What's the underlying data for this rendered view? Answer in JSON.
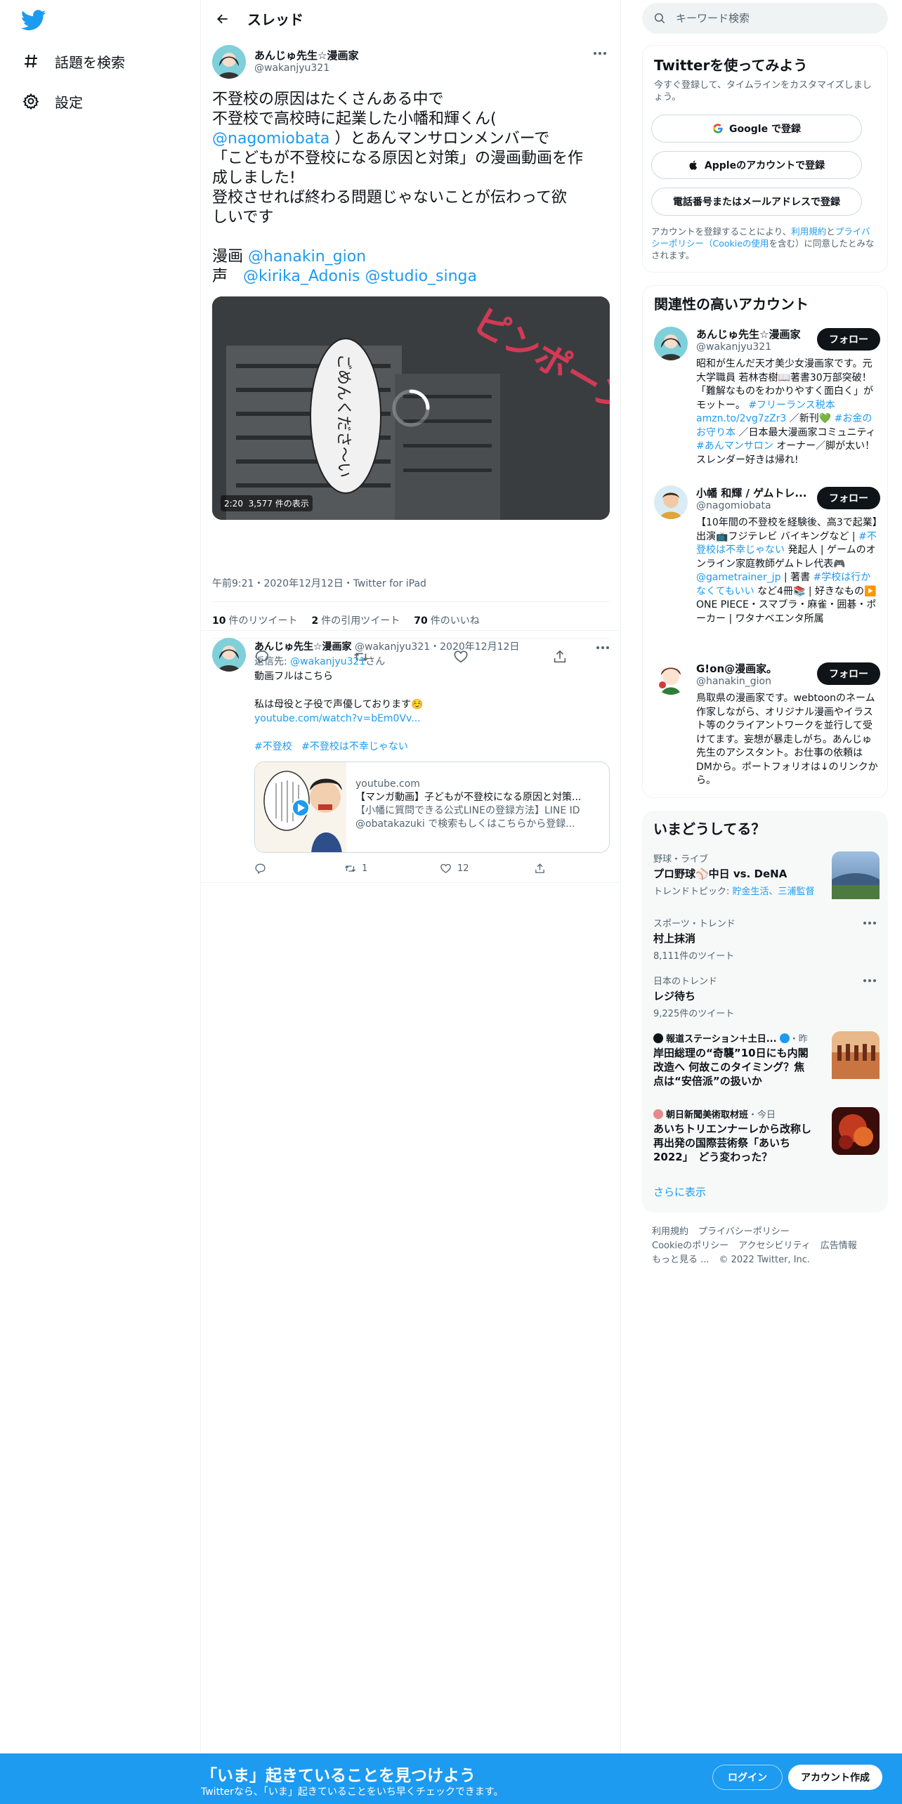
{
  "nav": {
    "items": [
      {
        "label": "話題を検索",
        "icon": "hashtag-icon"
      },
      {
        "label": "設定",
        "icon": "gear-icon"
      }
    ]
  },
  "header": {
    "title": "スレッド"
  },
  "main_tweet": {
    "name": "あんじゅ先生☆漫画家",
    "handle": "@wakanjyu321",
    "text_lines": [
      "不登校の原因はたくさんある中で",
      "不登校で高校時に起業した小幡和輝くん(",
      "@nagomiobata",
      " ）とあんマンサロンメンバーで",
      "「こどもが不登校になる原因と対策」の漫画動画を作",
      "成しました!",
      "登校させれば終わる問題じゃないことが伝わって欲",
      "しいです",
      "",
      "漫画 ",
      "@hanakin_gion",
      "声　",
      "@kirika_Adonis",
      " ",
      "@studio_singa"
    ],
    "video": {
      "duration": "2:20",
      "views": "3,577 件の表示",
      "art_text_1": "ピンポーン",
      "art_text_2": "ごめんくださ〜い"
    },
    "timestamp": "午前9:21・2020年12月12日・Twitter for iPad",
    "stats": {
      "retweets": "10",
      "retweets_label": "件のリツイート",
      "quotes": "2",
      "quotes_label": "件の引用ツイート",
      "likes": "70",
      "likes_label": "件のいいね"
    }
  },
  "reply": {
    "name": "あんじゅ先生☆漫画家",
    "handle": "@wakanjyu321",
    "date": "・2020年12月12日",
    "reply_to_prefix": "返信先: ",
    "reply_to_handle": "@wakanjyu321",
    "reply_to_suffix": "さん",
    "line1": "動画フルはこちら",
    "line2": "私は母役と子役で声優しております☺️",
    "link": "youtube.com/watch?v=bEm0Vv...",
    "hashtag1": "#不登校",
    "hashtag2": "#不登校は不幸じゃない",
    "card": {
      "domain": "youtube.com",
      "title": "【マンガ動画】子どもが不登校になる原因と対策...",
      "desc1": "【小幡に質問できる公式LINEの登録方法】LINE ID",
      "desc2": "@obatakazuki で検索もしくはこちらから登録..."
    },
    "stats": {
      "replies": "",
      "retweets": "1",
      "likes": "12"
    }
  },
  "search": {
    "placeholder": "キーワード検索"
  },
  "signup_box": {
    "title": "Twitterを使ってみよう",
    "subtitle": "今すぐ登録して、タイムラインをカスタマイズしましょう。",
    "google": "Google で登録",
    "apple": "Appleのアカウントで登録",
    "phone": "電話番号またはメールアドレスで登録",
    "terms_pre": "アカウントを登録することにより、",
    "terms_link1": "利用規約",
    "terms_mid": "と",
    "terms_link2": "プライバシーポリシー（Cookieの使用",
    "terms_post": "を含む）に同意したとみなされます。"
  },
  "related": {
    "title": "関連性の高いアカウント",
    "follow": "フォロー",
    "accounts": [
      {
        "name": "あんじゅ先生☆漫画家",
        "handle": "@wakanjyu321"
      },
      {
        "name": "小幡 和輝 / ゲムトレ...",
        "handle": "@nagomiobata"
      },
      {
        "name": "G!on@漫画家。",
        "handle": "@hanakin_gion"
      }
    ],
    "bio1": {
      "p1": "昭和が生んだ天才美少女漫画家です。元大学職員 若林杏樹📖著書30万部突破！「難解なものをわかりやすく面白く」がモットー。",
      "l1": "#フリーランス税本",
      "l2": "amzn.to/2vg7zZr3",
      "p2": "／新刊💚",
      "l3": "#お金のお守り本",
      "p3": "／日本最大漫画家コミュニティ",
      "l4": "#あんマンサロン",
      "p4": "オーナー／脚が太い！スレンダー好きは帰れ!"
    },
    "bio2": {
      "p1": "【10年間の不登校を経験後、高3で起業】出演📺フジテレビ バイキングなど |",
      "l1": "#不登校は不幸じゃない",
      "p2": "発起人 | ゲームのオンライン家庭教師ゲムトレ代表🎮",
      "l2": "@gametrainer_jp",
      "p3": "| 著書",
      "l3": "#学校は行かなくてもいい",
      "p4": "など4冊📚 | 好きなもの▶️ ONE PIECE・スマブラ・麻雀・囲碁・ポーカー | ワタナベエンタ所属"
    },
    "bio3": "鳥取県の漫画家です。webtoonのネーム作家しながら、オリジナル漫画やイラスト等のクライアントワークを並行して受けてます。妄想が暴走しがち。あんじゅ先生のアシスタント。お仕事の依頼はDMから。ポートフォリオは↓のリンクから。"
  },
  "trends": {
    "title": "いまどうしてる？",
    "items": [
      {
        "cat": "野球・ライブ",
        "title": "プロ野球⚾️中日 vs. DeNA",
        "sub_pre": "トレンドトピック: ",
        "sub_link": "貯金生活、三浦監督"
      },
      {
        "cat": "スポーツ・トレンド",
        "title": "村上抹消",
        "sub": "8,111件のツイート"
      },
      {
        "cat": "日本のトレンド",
        "title": "レジ待ち",
        "sub": "9,225件のツイート"
      },
      {
        "cat": "報道ステーション＋土日...",
        "cat_time": "・昨夜",
        "title": "岸田総理の“奇襲”10日にも内閣改造へ 何故このタイミング？焦点は“安倍派”の扱いか"
      },
      {
        "cat": "朝日新聞美術取材班",
        "cat_time": "・今日",
        "title": "あいちトリエンナーレから改称し再出発の国際芸術祭「あいち2022」　どう変わった？"
      }
    ],
    "show_more": "さらに表示"
  },
  "footer": {
    "links": [
      "利用規約",
      "プライバシーポリシー",
      "Cookieのポリシー",
      "アクセシビリティ",
      "広告情報",
      "もっと見る ..."
    ],
    "copyright": "© 2022 Twitter, Inc."
  },
  "bottom_bar": {
    "title": "「いま」起きていることを見つけよう",
    "subtitle": "Twitterなら、「いま」起きていることをいち早くチェックできます。",
    "login": "ログイン",
    "signup": "アカウント作成"
  },
  "colors": {
    "accent": "#1d9bf0",
    "text": "#0f1419",
    "muted": "#536471",
    "border": "#eff3f4"
  }
}
